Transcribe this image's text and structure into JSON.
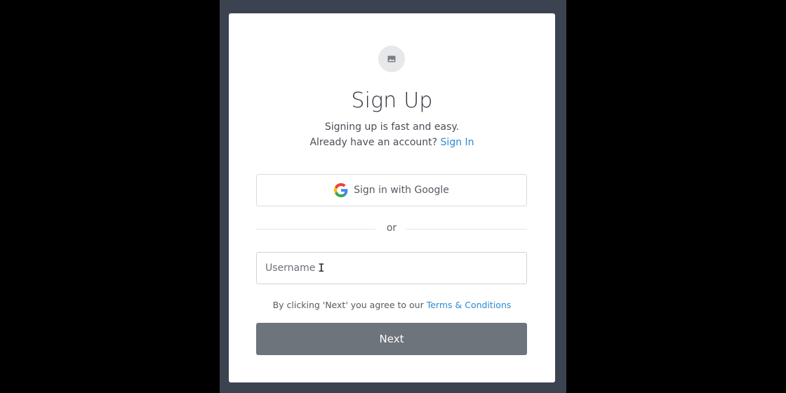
{
  "signup": {
    "logo_icon": "image-placeholder-icon",
    "title": "Sign Up",
    "subtitle": "Signing up is fast and easy.",
    "account_prompt": "Already have an account?",
    "sign_in_link": "Sign In",
    "google_button": {
      "label": "Sign in with Google",
      "icon": "google-logo-icon"
    },
    "divider_text": "or",
    "username": {
      "placeholder": "Username",
      "value": ""
    },
    "terms_prefix": "By clicking 'Next' you agree to our",
    "terms_link": "Terms & Conditions",
    "next_label": "Next"
  },
  "colors": {
    "frame": "#3b4250",
    "link": "#2b8ad1",
    "next_button": "#6e747b"
  }
}
